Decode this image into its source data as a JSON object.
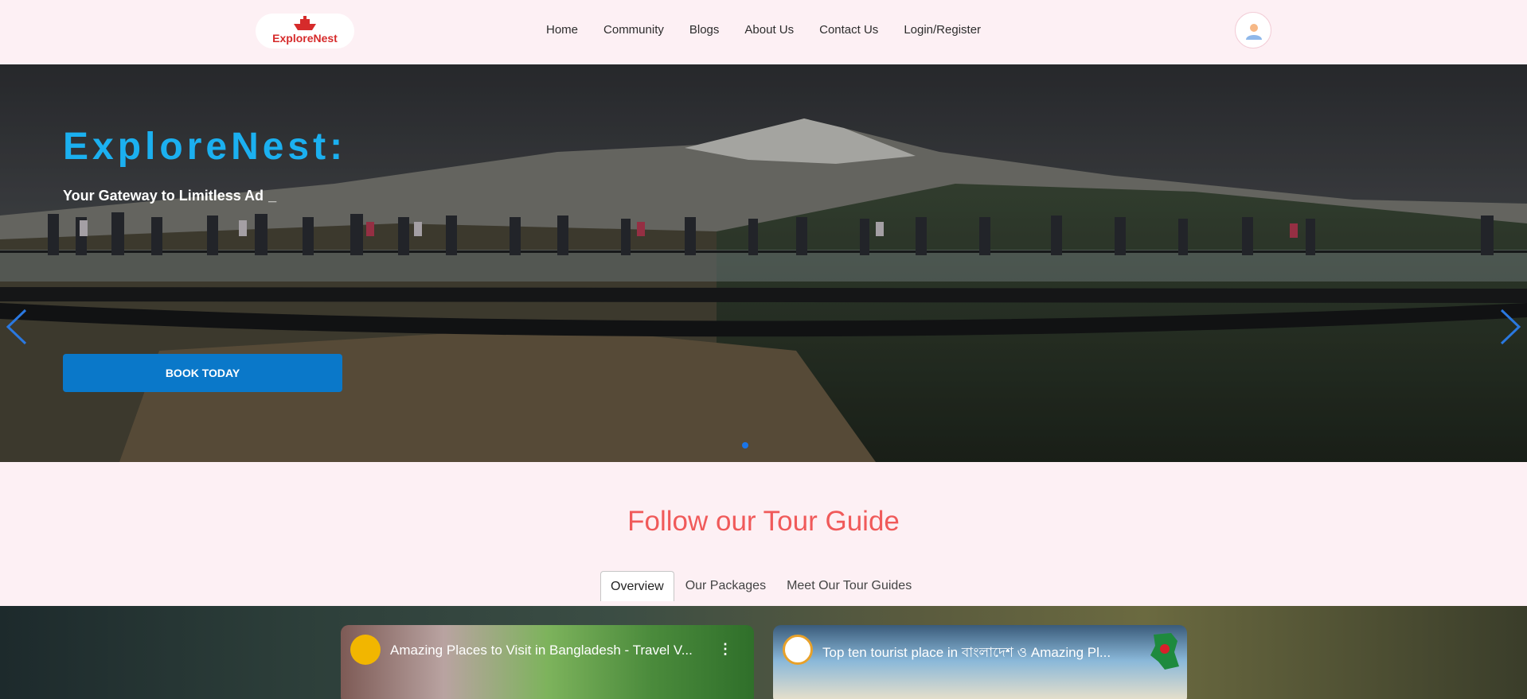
{
  "brand": {
    "name": "ExploreNest"
  },
  "nav": {
    "items": [
      {
        "label": "Home"
      },
      {
        "label": "Community"
      },
      {
        "label": "Blogs"
      },
      {
        "label": "About Us"
      },
      {
        "label": "Contact Us"
      },
      {
        "label": "Login/Register"
      }
    ]
  },
  "hero": {
    "title": "ExploreNest:",
    "subtitle": "Your Gateway to Limitless Ad",
    "cursor": "_",
    "cta_label": "BOOK TODAY",
    "slide_count": 1,
    "active_slide": 1
  },
  "guide": {
    "title": "Follow our Tour Guide",
    "tabs": [
      {
        "label": "Overview",
        "active": true
      },
      {
        "label": "Our Packages",
        "active": false
      },
      {
        "label": "Meet Our Tour Guides",
        "active": false
      }
    ],
    "videos": [
      {
        "title": "Amazing Places to Visit in Bangladesh - Travel V..."
      },
      {
        "title": "Top ten tourist place in বাংলাদেশ ও Amazing Pl..."
      }
    ]
  },
  "colors": {
    "page_bg": "#fdf0f4",
    "hero_title": "#1bb0f0",
    "cta_bg": "#0a78c9",
    "section_title": "#f05a5a",
    "logo_red": "#d62b2b",
    "arrow_blue": "#2a78e0"
  },
  "icons": {
    "logo": "boat-icon",
    "avatar": "user-icon",
    "prev": "chevron-left-icon",
    "next": "chevron-right-icon",
    "menu": "kebab-menu-icon"
  }
}
